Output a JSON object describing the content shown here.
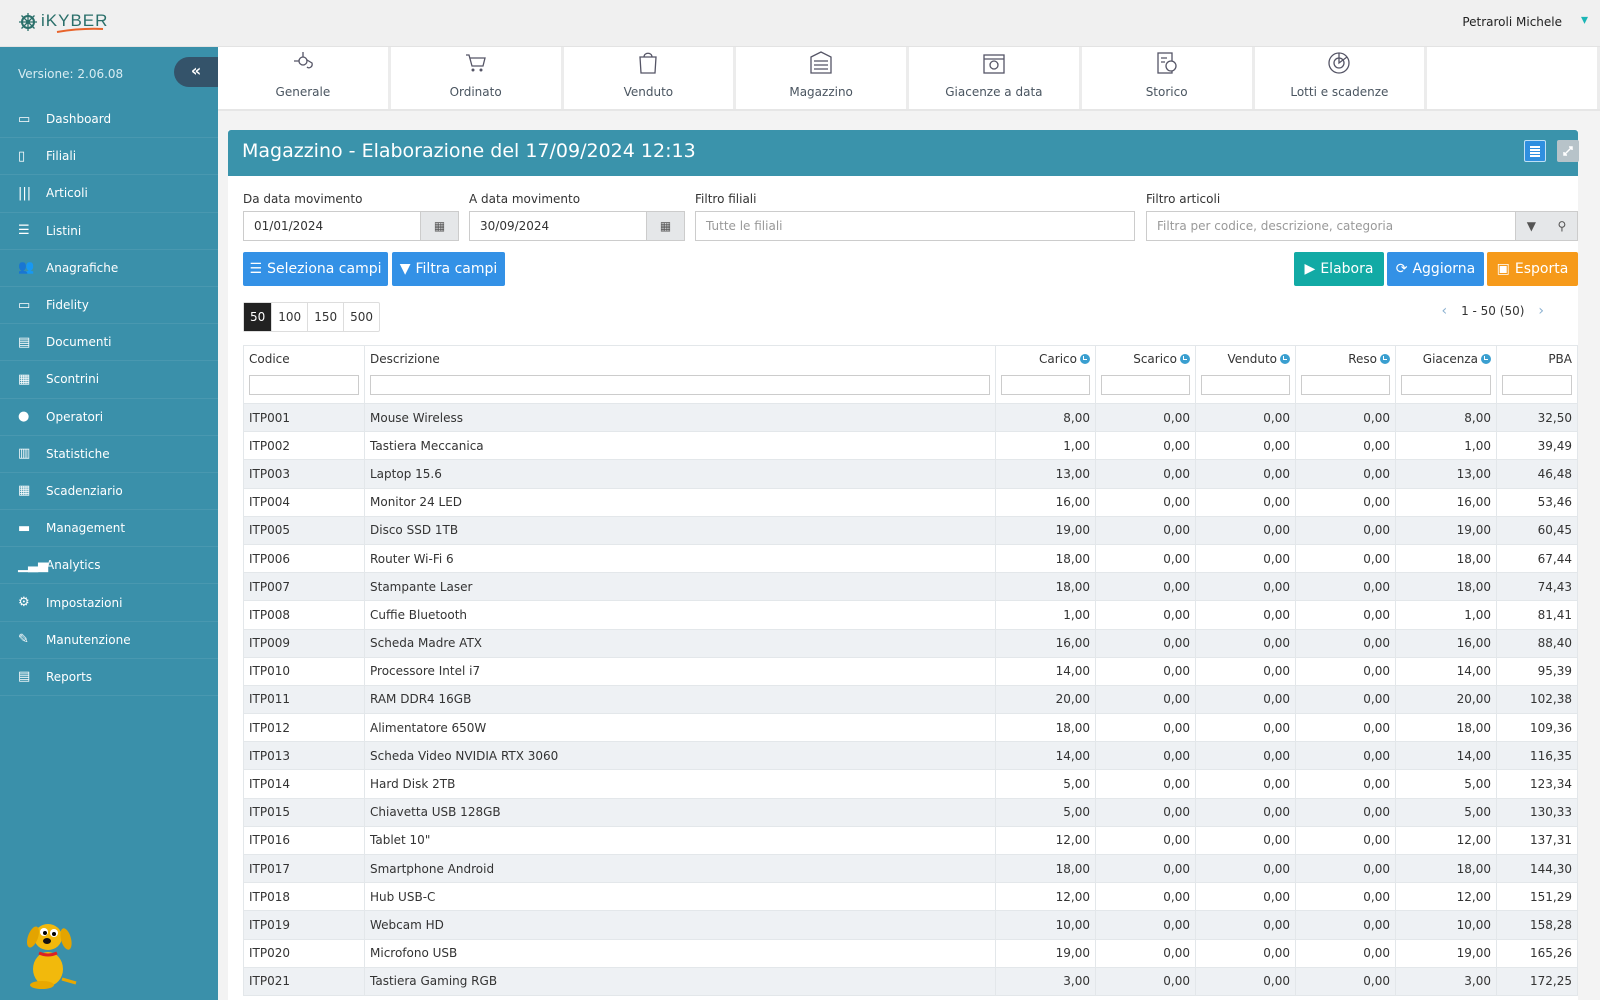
{
  "app": {
    "logo_text": "KYBER",
    "user": "Petraroli Michele",
    "version": "Versione: 2.06.08",
    "accent": "#3a90aa"
  },
  "sidebar": {
    "items": [
      {
        "label": "Dashboard",
        "icon": "laptop-icon"
      },
      {
        "label": "Filiali",
        "icon": "building-icon"
      },
      {
        "label": "Articoli",
        "icon": "barcode-icon"
      },
      {
        "label": "Listini",
        "icon": "list-icon"
      },
      {
        "label": "Anagrafiche",
        "icon": "users-icon"
      },
      {
        "label": "Fidelity",
        "icon": "credit-card-icon"
      },
      {
        "label": "Documenti",
        "icon": "document-icon"
      },
      {
        "label": "Scontrini",
        "icon": "cash-register-icon"
      },
      {
        "label": "Operatori",
        "icon": "user-icon"
      },
      {
        "label": "Statistiche",
        "icon": "bar-chart-icon"
      },
      {
        "label": "Scadenziario",
        "icon": "calendar-icon"
      },
      {
        "label": "Management",
        "icon": "briefcase-icon"
      },
      {
        "label": "Analytics",
        "icon": "signal-icon"
      },
      {
        "label": "Impostazioni",
        "icon": "gears-icon"
      },
      {
        "label": "Manutenzione",
        "icon": "wrench-icon"
      },
      {
        "label": "Reports",
        "icon": "pdf-icon"
      }
    ]
  },
  "tabs": [
    {
      "label": "Generale"
    },
    {
      "label": "Ordinato"
    },
    {
      "label": "Venduto"
    },
    {
      "label": "Magazzino"
    },
    {
      "label": "Giacenze a data"
    },
    {
      "label": "Storico"
    },
    {
      "label": "Lotti e scadenze"
    }
  ],
  "panel": {
    "title": "Magazzino - Elaborazione del 17/09/2024 12:13"
  },
  "filters": {
    "from_label": "Da data movimento",
    "from_value": "01/01/2024",
    "to_label": "A data movimento",
    "to_value": "30/09/2024",
    "branch_label": "Filtro filiali",
    "branch_placeholder": "Tutte le filiali",
    "article_label": "Filtro articoli",
    "article_placeholder": "Filtra per codice, descrizione, categoria"
  },
  "buttons": {
    "select_fields": "Seleziona campi",
    "filter_fields": "Filtra campi",
    "process": "Elabora",
    "refresh": "Aggiorna",
    "export": "Esporta"
  },
  "page_sizes": [
    "50",
    "100",
    "150",
    "500"
  ],
  "page_size_selected": "50",
  "pagination": {
    "range": "1 - 50 (50)"
  },
  "table": {
    "columns": [
      "Codice",
      "Descrizione",
      "Carico",
      "Scarico",
      "Venduto",
      "Reso",
      "Giacenza",
      "PBA"
    ],
    "rows": [
      [
        "ITP001",
        "Mouse Wireless",
        "8,00",
        "0,00",
        "0,00",
        "0,00",
        "8,00",
        "32,50"
      ],
      [
        "ITP002",
        "Tastiera Meccanica",
        "1,00",
        "0,00",
        "0,00",
        "0,00",
        "1,00",
        "39,49"
      ],
      [
        "ITP003",
        "Laptop 15.6",
        "13,00",
        "0,00",
        "0,00",
        "0,00",
        "13,00",
        "46,48"
      ],
      [
        "ITP004",
        "Monitor 24 LED",
        "16,00",
        "0,00",
        "0,00",
        "0,00",
        "16,00",
        "53,46"
      ],
      [
        "ITP005",
        "Disco SSD 1TB",
        "19,00",
        "0,00",
        "0,00",
        "0,00",
        "19,00",
        "60,45"
      ],
      [
        "ITP006",
        "Router Wi-Fi 6",
        "18,00",
        "0,00",
        "0,00",
        "0,00",
        "18,00",
        "67,44"
      ],
      [
        "ITP007",
        "Stampante Laser",
        "18,00",
        "0,00",
        "0,00",
        "0,00",
        "18,00",
        "74,43"
      ],
      [
        "ITP008",
        "Cuffie Bluetooth",
        "1,00",
        "0,00",
        "0,00",
        "0,00",
        "1,00",
        "81,41"
      ],
      [
        "ITP009",
        "Scheda Madre ATX",
        "16,00",
        "0,00",
        "0,00",
        "0,00",
        "16,00",
        "88,40"
      ],
      [
        "ITP010",
        "Processore Intel i7",
        "14,00",
        "0,00",
        "0,00",
        "0,00",
        "14,00",
        "95,39"
      ],
      [
        "ITP011",
        "RAM DDR4 16GB",
        "20,00",
        "0,00",
        "0,00",
        "0,00",
        "20,00",
        "102,38"
      ],
      [
        "ITP012",
        "Alimentatore 650W",
        "18,00",
        "0,00",
        "0,00",
        "0,00",
        "18,00",
        "109,36"
      ],
      [
        "ITP013",
        "Scheda Video NVIDIA RTX 3060",
        "14,00",
        "0,00",
        "0,00",
        "0,00",
        "14,00",
        "116,35"
      ],
      [
        "ITP014",
        "Hard Disk 2TB",
        "5,00",
        "0,00",
        "0,00",
        "0,00",
        "5,00",
        "123,34"
      ],
      [
        "ITP015",
        "Chiavetta USB 128GB",
        "5,00",
        "0,00",
        "0,00",
        "0,00",
        "5,00",
        "130,33"
      ],
      [
        "ITP016",
        "Tablet 10\"",
        "12,00",
        "0,00",
        "0,00",
        "0,00",
        "12,00",
        "137,31"
      ],
      [
        "ITP017",
        "Smartphone Android",
        "18,00",
        "0,00",
        "0,00",
        "0,00",
        "18,00",
        "144,30"
      ],
      [
        "ITP018",
        "Hub USB-C",
        "12,00",
        "0,00",
        "0,00",
        "0,00",
        "12,00",
        "151,29"
      ],
      [
        "ITP019",
        "Webcam HD",
        "10,00",
        "0,00",
        "0,00",
        "0,00",
        "10,00",
        "158,28"
      ],
      [
        "ITP020",
        "Microfono USB",
        "19,00",
        "0,00",
        "0,00",
        "0,00",
        "19,00",
        "165,26"
      ],
      [
        "ITP021",
        "Tastiera Gaming RGB",
        "3,00",
        "0,00",
        "0,00",
        "0,00",
        "3,00",
        "172,25"
      ]
    ]
  }
}
